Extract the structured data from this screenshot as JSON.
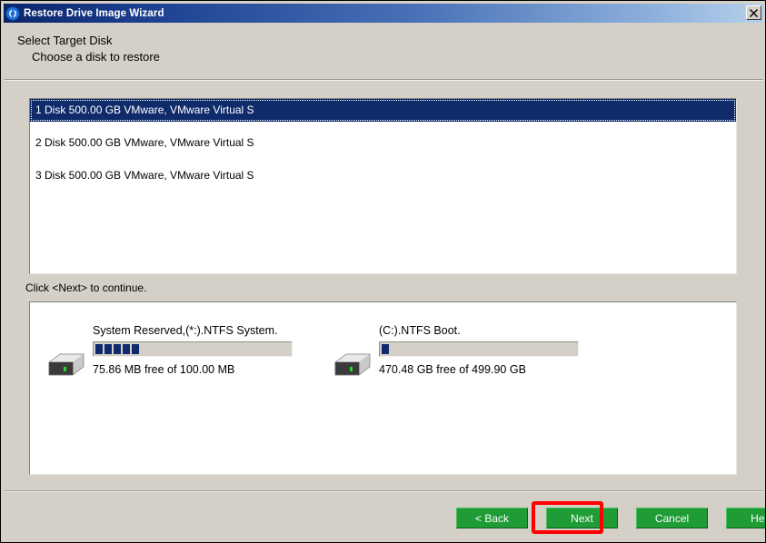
{
  "window": {
    "title": "Restore Drive Image Wizard",
    "title_icon": "restore-circular-arrows-icon",
    "close_label": "×",
    "close_icon": "close-icon",
    "accent_titlebar_dark": "#0a246a",
    "accent_titlebar_light": "#b6d0ea",
    "dialog_face": "#d4d0c8"
  },
  "header": {
    "title": "Select Target Disk",
    "subtitle": "Choose a disk to restore"
  },
  "disk_list": {
    "selected_index": 0,
    "selection_color": "#0f2b6b",
    "items": [
      {
        "label": "1 Disk 500.00 GB VMware,  VMware Virtual S"
      },
      {
        "label": "2 Disk 500.00 GB VMware,  VMware Virtual S"
      },
      {
        "label": "3 Disk 500.00 GB VMware,  VMware Virtual S"
      }
    ]
  },
  "hint": {
    "text": "Click <Next> to continue."
  },
  "partitions": {
    "bar_fill_color": "#102a6e",
    "items": [
      {
        "icon": "hard-drive-icon",
        "label": "System Reserved,(*:).NTFS System.",
        "free_text": "75.86 MB free of 100.00 MB",
        "segments": 5,
        "free_value": "75.86 MB",
        "total_value": "100.00 MB"
      },
      {
        "icon": "hard-drive-icon",
        "label": "(C:).NTFS Boot.",
        "free_text": "470.48 GB free of 499.90 GB",
        "segments": 1,
        "free_value": "470.48 GB",
        "total_value": "499.90 GB"
      }
    ]
  },
  "footer": {
    "button_color": "#1f9c36",
    "highlight_color": "#ff0000",
    "buttons": [
      {
        "label": "< Back",
        "name": "back-button",
        "highlighted": false
      },
      {
        "label": "Next",
        "name": "next-button",
        "highlighted": true
      },
      {
        "label": "Cancel",
        "name": "cancel-button",
        "highlighted": false
      },
      {
        "label": "Help",
        "name": "help-button",
        "highlighted": false
      }
    ]
  }
}
